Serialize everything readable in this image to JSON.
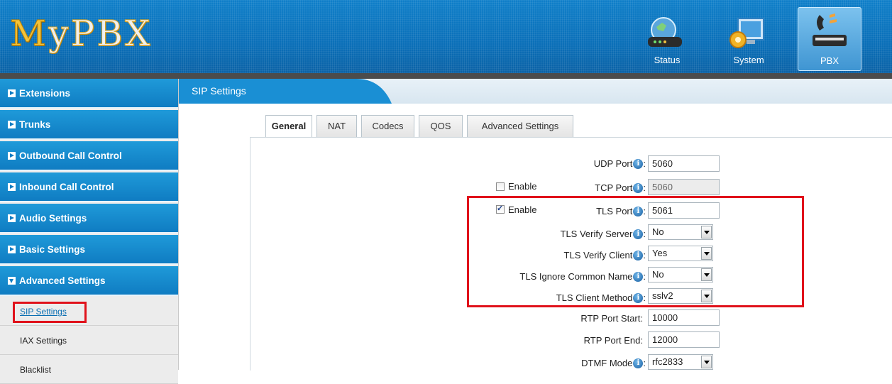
{
  "header": {
    "logo": "MyPBX",
    "buttons": [
      {
        "label": "Status"
      },
      {
        "label": "System"
      },
      {
        "label": "PBX"
      }
    ]
  },
  "sidebar": {
    "sections": [
      {
        "label": "Extensions"
      },
      {
        "label": "Trunks"
      },
      {
        "label": "Outbound Call Control"
      },
      {
        "label": "Inbound Call Control"
      },
      {
        "label": "Audio Settings"
      },
      {
        "label": "Basic Settings"
      },
      {
        "label": "Advanced Settings"
      }
    ],
    "subitems": [
      {
        "label": "SIP Settings"
      },
      {
        "label": "IAX Settings"
      },
      {
        "label": "Blacklist"
      }
    ]
  },
  "main": {
    "title": "SIP Settings",
    "tabs": [
      {
        "label": "General"
      },
      {
        "label": "NAT"
      },
      {
        "label": "Codecs"
      },
      {
        "label": "QOS"
      },
      {
        "label": "Advanced Settings"
      }
    ],
    "form": {
      "udp_port": {
        "label": "UDP Port",
        "value": "5060"
      },
      "tcp_enable": {
        "label": "Enable",
        "checked": false
      },
      "tcp_port": {
        "label": "TCP Port",
        "value": "5060"
      },
      "tls_enable": {
        "label": "Enable",
        "checked": true
      },
      "tls_port": {
        "label": "TLS Port",
        "value": "5061"
      },
      "tls_verify_server": {
        "label": "TLS Verify Server",
        "value": "No"
      },
      "tls_verify_client": {
        "label": "TLS Verify Client",
        "value": "Yes"
      },
      "tls_ignore_cn": {
        "label": "TLS Ignore Common Name",
        "value": "No"
      },
      "tls_client_method": {
        "label": "TLS Client Method",
        "value": "sslv2"
      },
      "rtp_port_start": {
        "label": "RTP Port Start:",
        "value": "10000"
      },
      "rtp_port_end": {
        "label": "RTP Port End:",
        "value": "12000"
      },
      "dtmf_mode": {
        "label": "DTMF Mode",
        "value": "rfc2833"
      }
    },
    "info_glyph": "i",
    "colon": ":"
  },
  "colors": {
    "header_blue": "#0a6fb8",
    "nav_blue": "#1589ce",
    "highlight_red": "#e0121b"
  },
  "icons": [
    "status-router-icon",
    "system-monitor-gear-icon",
    "pbx-phone-icon",
    "info-icon",
    "triangle-right-icon"
  ]
}
